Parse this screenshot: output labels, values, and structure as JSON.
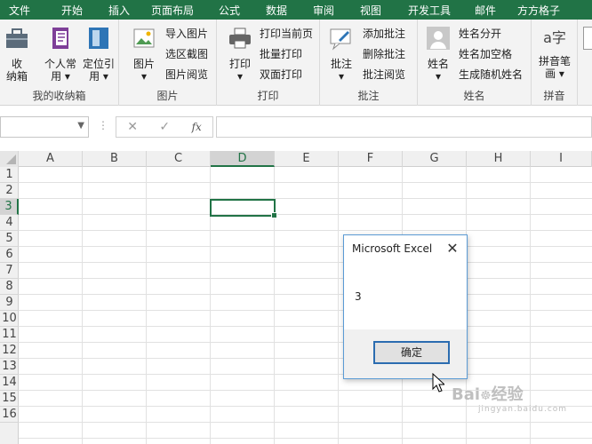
{
  "menu": {
    "tabs": [
      "文件",
      "开始",
      "插入",
      "页面布局",
      "公式",
      "数据",
      "审阅",
      "视图",
      "开发工具",
      "邮件",
      "方方格子"
    ]
  },
  "ribbon": {
    "groups": {
      "favorites": {
        "label": "我的收纳箱",
        "items": [
          "收\n纳箱",
          "个人常\n用 ▾",
          "定位引\n用 ▾"
        ]
      },
      "picture": {
        "label": "图片",
        "big": "图片\n▾",
        "small": [
          "导入图片",
          "选区截图",
          "图片阅览"
        ]
      },
      "print": {
        "label": "打印",
        "big": "打印\n▾",
        "small": [
          "打印当前页",
          "批量打印",
          "双面打印"
        ]
      },
      "comment": {
        "label": "批注",
        "big": "批注\n▾",
        "small": [
          "添加批注",
          "删除批注",
          "批注阅览"
        ]
      },
      "name": {
        "label": "姓名",
        "big": "姓名\n▾",
        "small": [
          "姓名分开",
          "姓名加空格",
          "生成随机姓名"
        ]
      },
      "pinyin": {
        "label": "拼音",
        "big": "拼音笔\n画 ▾"
      }
    }
  },
  "formula_bar": {
    "cancel": "✕",
    "enter": "✓",
    "fx": "fx"
  },
  "grid": {
    "columns": [
      "A",
      "B",
      "C",
      "D",
      "E",
      "F",
      "G",
      "H",
      "I"
    ],
    "rows": [
      "1",
      "2",
      "3",
      "4",
      "5",
      "6",
      "7",
      "8",
      "9",
      "10",
      "11",
      "12",
      "13",
      "14",
      "15",
      "16"
    ],
    "selected_column": "D",
    "selected_row": "3"
  },
  "dialog": {
    "title": "Microsoft Excel",
    "message": "3",
    "ok_label": "确定"
  },
  "colors": {
    "accent": "#217346",
    "dialog_border": "#5b9bd5"
  }
}
